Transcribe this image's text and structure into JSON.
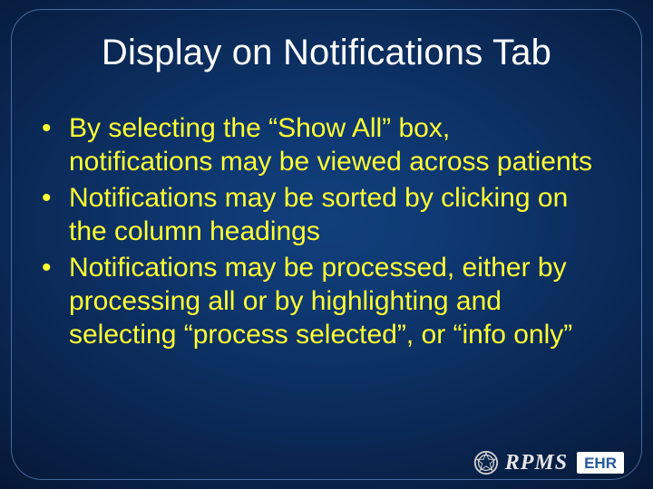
{
  "title": "Display on Notifications Tab",
  "bullets": [
    "By selecting the “Show All” box, notifications may be viewed across patients",
    "Notifications may be sorted by clicking on the column headings",
    "Notifications may be processed, either by processing all or by highlighting and selecting “process selected”, or “info only”"
  ],
  "logo": {
    "rpms": "RPMS",
    "ehr": "EHR"
  }
}
